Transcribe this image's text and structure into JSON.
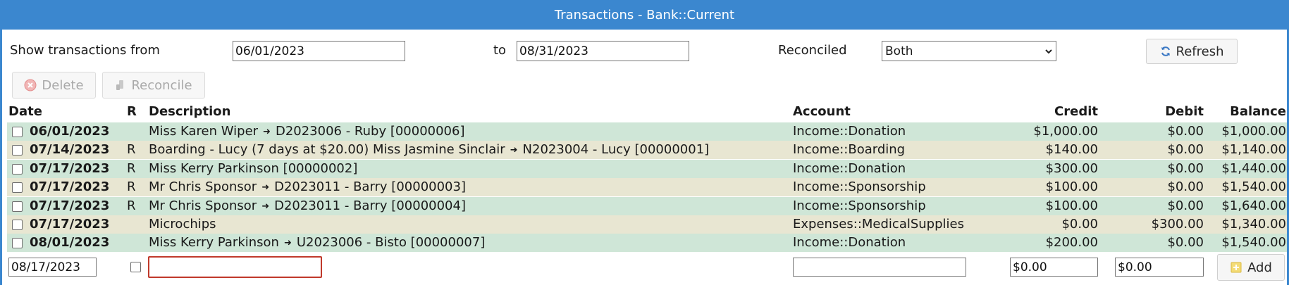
{
  "title": "Transactions - Bank::Current",
  "filter": {
    "from_label": "Show transactions from",
    "from_value": "06/01/2023",
    "to_label": "to",
    "to_value": "08/31/2023",
    "reconciled_label": "Reconciled",
    "reconciled_value": "Both",
    "refresh_label": "Refresh"
  },
  "toolbar": {
    "delete_label": "Delete",
    "reconcile_label": "Reconcile"
  },
  "columns": {
    "date": "Date",
    "r": "R",
    "description": "Description",
    "account": "Account",
    "credit": "Credit",
    "debit": "Debit",
    "balance": "Balance"
  },
  "rows": [
    {
      "date": "06/01/2023",
      "r": "",
      "desc": "Miss Karen Wiper",
      "link": "D2023006 - Ruby [00000006]",
      "account": "Income::Donation",
      "credit": "$1,000.00",
      "debit": "$0.00",
      "balance": "$1,000.00"
    },
    {
      "date": "07/14/2023",
      "r": "R",
      "desc": "Boarding - Lucy (7 days at $20.00) Miss Jasmine Sinclair",
      "link": "N2023004 - Lucy [00000001]",
      "account": "Income::Boarding",
      "credit": "$140.00",
      "debit": "$0.00",
      "balance": "$1,140.00"
    },
    {
      "date": "07/17/2023",
      "r": "R",
      "desc": "Miss Kerry Parkinson [00000002]",
      "link": "",
      "account": "Income::Donation",
      "credit": "$300.00",
      "debit": "$0.00",
      "balance": "$1,440.00"
    },
    {
      "date": "07/17/2023",
      "r": "R",
      "desc": "Mr Chris Sponsor",
      "link": "D2023011 - Barry [00000003]",
      "account": "Income::Sponsorship",
      "credit": "$100.00",
      "debit": "$0.00",
      "balance": "$1,540.00"
    },
    {
      "date": "07/17/2023",
      "r": "R",
      "desc": "Mr Chris Sponsor",
      "link": "D2023011 - Barry [00000004]",
      "account": "Income::Sponsorship",
      "credit": "$100.00",
      "debit": "$0.00",
      "balance": "$1,640.00"
    },
    {
      "date": "07/17/2023",
      "r": "",
      "desc": "Microchips",
      "link": "",
      "account": "Expenses::MedicalSupplies",
      "credit": "$0.00",
      "debit": "$300.00",
      "balance": "$1,340.00"
    },
    {
      "date": "08/01/2023",
      "r": "",
      "desc": "Miss Kerry Parkinson",
      "link": "U2023006 - Bisto [00000007]",
      "account": "Income::Donation",
      "credit": "$200.00",
      "debit": "$0.00",
      "balance": "$1,540.00"
    }
  ],
  "new_row": {
    "date": "08/17/2023",
    "description": "",
    "account": "",
    "credit": "$0.00",
    "debit": "$0.00",
    "add_label": "Add"
  },
  "icons": {
    "refresh": "refresh-icon",
    "delete": "delete-icon",
    "reconcile": "reconcile-icon",
    "add": "add-icon",
    "arrow": "arrow-icon"
  },
  "colors": {
    "titlebar": "#3b87cf",
    "row_green": "#cfe6d7",
    "row_tan": "#e8e6d2",
    "desc_focus_border": "#c0392b"
  }
}
